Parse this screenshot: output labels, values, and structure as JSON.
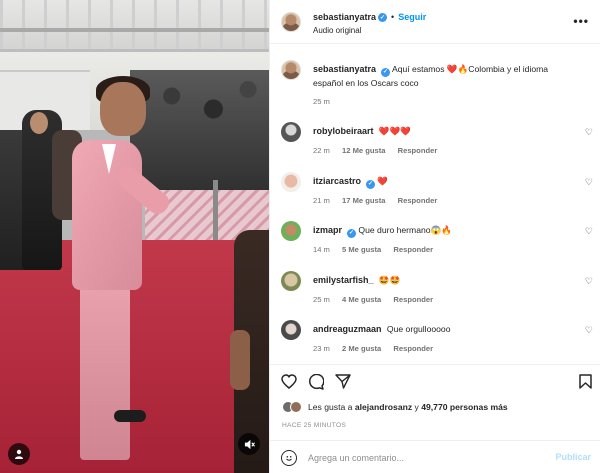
{
  "post": {
    "username": "sebastianyatra",
    "follow_label": "Seguir",
    "separator": "•",
    "audio": "Audio original",
    "more_icon": "more-options-icon"
  },
  "caption": {
    "username": "sebastianyatra",
    "text": "Aquí estamos ❤️🔥Colombia y el idioma español en los Oscars coco",
    "time": "25 m"
  },
  "comments": [
    {
      "username": "robylobeiraart",
      "verified": false,
      "text": "❤️❤️❤️",
      "time": "22 m",
      "likes": "12 Me gusta",
      "reply": "Responder"
    },
    {
      "username": "itziarcastro",
      "verified": true,
      "text": "❤️",
      "time": "21 m",
      "likes": "17 Me gusta",
      "reply": "Responder"
    },
    {
      "username": "izmapr",
      "verified": true,
      "text": "Que duro hermano😱🔥",
      "time": "14 m",
      "likes": "5 Me gusta",
      "reply": "Responder"
    },
    {
      "username": "emilystarfish_",
      "verified": false,
      "text": "🤩🤩",
      "time": "25 m",
      "likes": "4 Me gusta",
      "reply": "Responder"
    },
    {
      "username": "andreaguzmaan",
      "verified": false,
      "text": "Que orgullooooo",
      "time": "23 m",
      "likes": "2 Me gusta",
      "reply": "Responder"
    }
  ],
  "actions": {
    "icons": [
      "heart-icon",
      "comment-icon",
      "share-icon",
      "bookmark-icon"
    ],
    "likes_prefix": "Les gusta a",
    "likes_user": "alejandrosanz",
    "likes_connector": "y",
    "likes_count": "49,770 personas más",
    "timestamp": "HACE 25 MINUTOS"
  },
  "comment_box": {
    "placeholder": "Agrega un comentario...",
    "publish_label": "Publicar"
  },
  "colors": {
    "accent": "#0095f6",
    "verified": "#3897f0",
    "publish_disabled": "#b2dffc",
    "meta_text": "#737373"
  }
}
